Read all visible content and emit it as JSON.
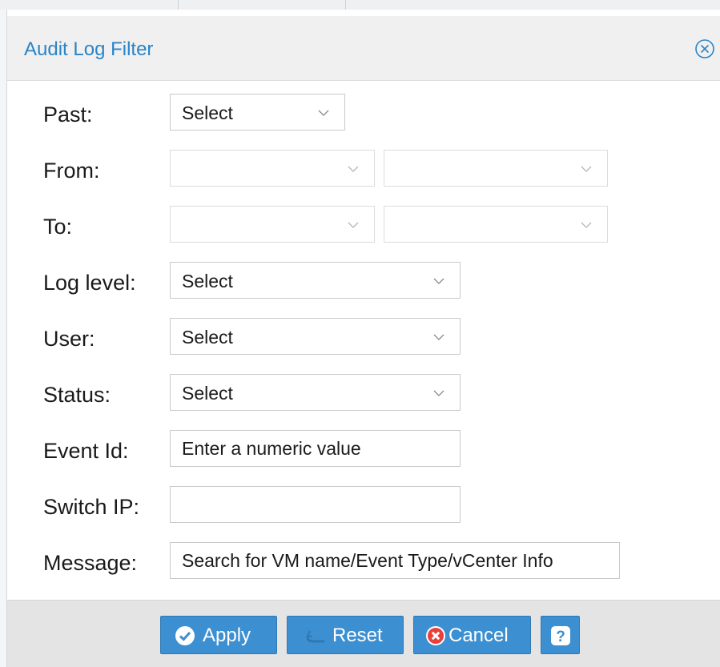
{
  "dialog": {
    "title": "Audit Log Filter",
    "close_icon": "close-circle-icon"
  },
  "form": {
    "past": {
      "label": "Past:",
      "value": "Select"
    },
    "from": {
      "label": "From:",
      "date_value": "",
      "time_value": ""
    },
    "to": {
      "label": "To:",
      "date_value": "",
      "time_value": ""
    },
    "log_level": {
      "label": "Log level:",
      "value": "Select"
    },
    "user": {
      "label": "User:",
      "value": "Select"
    },
    "status": {
      "label": "Status:",
      "value": "Select"
    },
    "event_id": {
      "label": "Event Id:",
      "placeholder": "Enter a numeric value"
    },
    "switch_ip": {
      "label": "Switch IP:",
      "placeholder": ""
    },
    "message": {
      "label": "Message:",
      "placeholder": "Search for VM name/Event Type/vCenter Info"
    }
  },
  "footer": {
    "apply_label": "Apply",
    "reset_label": "Reset",
    "cancel_label": "Cancel",
    "help_icon": "question-mark-icon"
  },
  "colors": {
    "accent": "#2a84c6",
    "button": "#3c8fd1",
    "cancel_icon": "#e8413b"
  }
}
